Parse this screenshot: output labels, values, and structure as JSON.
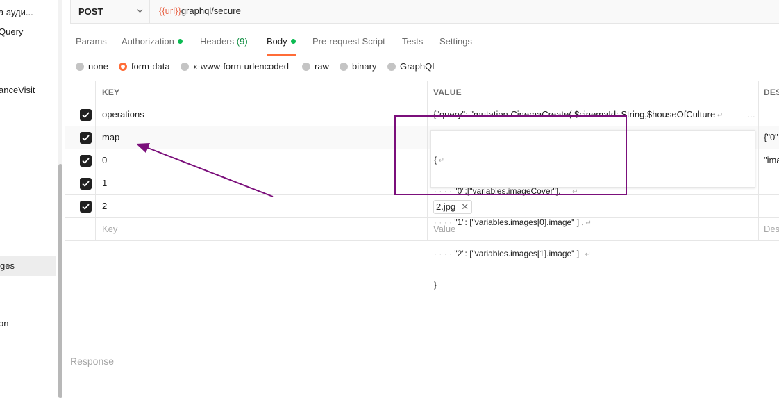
{
  "sidebar": {
    "items": [
      {
        "label": "а ауди..."
      },
      {
        "label": "Query"
      },
      {
        "label": "anceVisit"
      },
      {
        "label": "ges"
      },
      {
        "label": "on"
      }
    ]
  },
  "request": {
    "method": "POST",
    "url_variable": "{{url}}",
    "url_path": "graphql/secure"
  },
  "tabs": [
    {
      "label": "Params"
    },
    {
      "label": "Authorization"
    },
    {
      "label": "Headers",
      "count": "(9)"
    },
    {
      "label": "Body"
    },
    {
      "label": "Pre-request Script"
    },
    {
      "label": "Tests"
    },
    {
      "label": "Settings"
    }
  ],
  "body_types": [
    {
      "label": "none"
    },
    {
      "label": "form-data",
      "selected": true
    },
    {
      "label": "x-www-form-urlencoded"
    },
    {
      "label": "raw"
    },
    {
      "label": "binary"
    },
    {
      "label": "GraphQL"
    }
  ],
  "table": {
    "headers": {
      "key": "KEY",
      "value": "VALUE",
      "description": "DES"
    },
    "rows": [
      {
        "key": "operations",
        "value": "{\"query\": \"mutation CinemaCreate( $cinemaId: String,$houseOfCulture",
        "description": "",
        "checked": true
      },
      {
        "key": "map",
        "value": "",
        "description": "{\"0\"",
        "checked": true
      },
      {
        "key": "0",
        "value": "",
        "description": "\"ima",
        "checked": true
      },
      {
        "key": "1",
        "value": "",
        "description": "",
        "checked": true
      },
      {
        "key": "2",
        "value": "2.jpg",
        "description": "",
        "checked": true
      }
    ],
    "placeholders": {
      "key": "Key",
      "value": "Value",
      "description": "Des"
    }
  },
  "value_editor": {
    "lines": [
      "{",
      "\"0\":[\"variables.imageCover\"],",
      "\"1\": [\"variables.images[0].image\" ] ,",
      "\"2\": [\"variables.images[1].image\" ]",
      "}"
    ]
  },
  "response": {
    "label": "Response"
  },
  "colors": {
    "accent": "#ff6c37",
    "status_dot": "#0cbb52",
    "annotation": "#7b0f7b",
    "url_variable": "#e8664a"
  }
}
